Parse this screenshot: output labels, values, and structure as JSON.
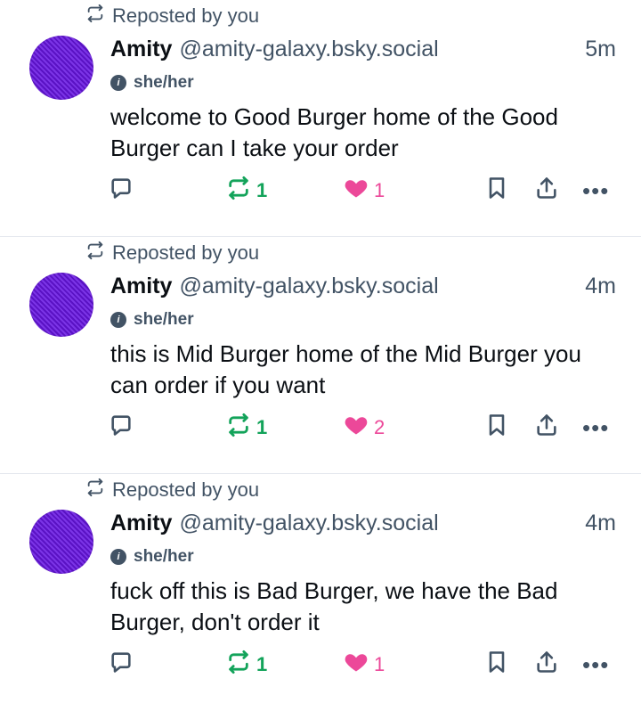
{
  "colors": {
    "accent_repost": "#13a35a",
    "accent_like": "#ec4899",
    "muted": "#425365",
    "avatar": "#6a1fd1"
  },
  "posts": [
    {
      "repost_label": "Reposted by you",
      "display_name": "Amity",
      "handle": "@amity-galaxy.bsky.social",
      "time": "5m",
      "pronouns": "she/her",
      "text": "welcome to Good Burger home of the Good Burger can I take your order",
      "repost_count": "1",
      "like_count": "1"
    },
    {
      "repost_label": "Reposted by you",
      "display_name": "Amity",
      "handle": "@amity-galaxy.bsky.social",
      "time": "4m",
      "pronouns": "she/her",
      "text": "this is Mid Burger home of the Mid Burger you can order if you want",
      "repost_count": "1",
      "like_count": "2"
    },
    {
      "repost_label": "Reposted by you",
      "display_name": "Amity",
      "handle": "@amity-galaxy.bsky.social",
      "time": "4m",
      "pronouns": "she/her",
      "text": "fuck off this is Bad Burger, we have the Bad Burger, don't order it",
      "repost_count": "1",
      "like_count": "1"
    }
  ],
  "icons": [
    "repost-icon",
    "reply-icon",
    "heart-icon",
    "bookmark-icon",
    "share-icon",
    "more-icon",
    "pronoun-info-icon"
  ]
}
